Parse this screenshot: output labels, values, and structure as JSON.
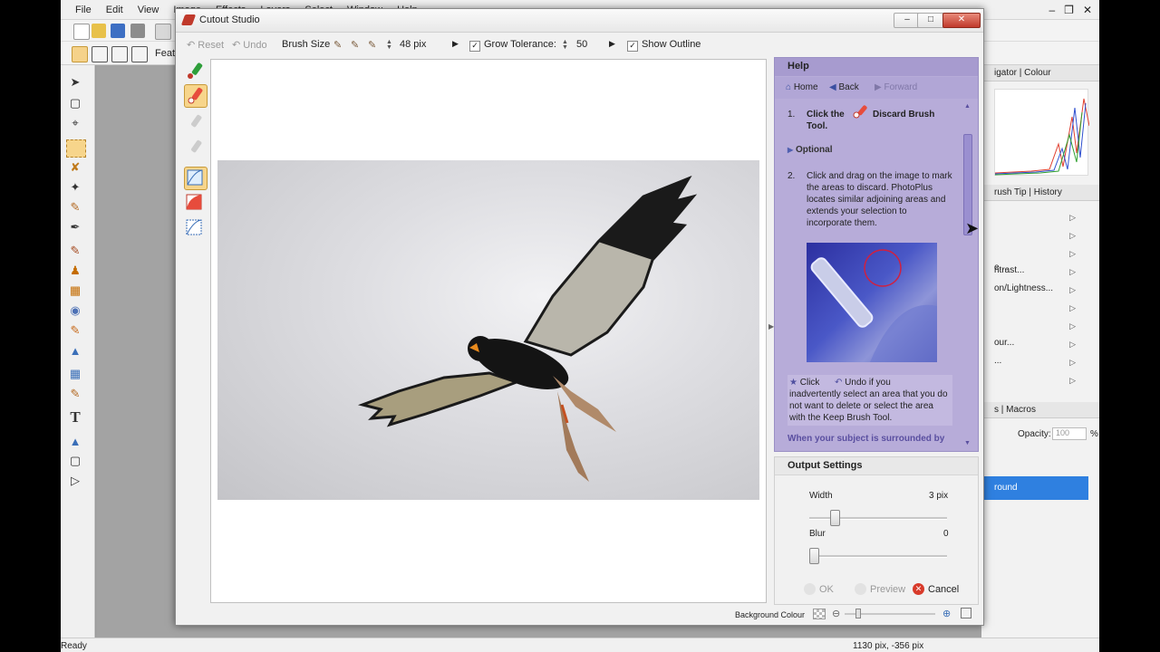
{
  "app": {
    "menu": [
      "File",
      "Edit",
      "View",
      "Image",
      "Effects",
      "Layers",
      "Select",
      "Window",
      "Help"
    ],
    "toolbar2_label": "Feat",
    "status_left": "Ready",
    "status_coords": "1130 pix, -356 pix",
    "right_panels": {
      "navigator_colour": "igator | Colour",
      "brushtip_history": "rush Tip | History",
      "adjust_items": [
        "e...",
        "ntrast...",
        "on/Lightness...",
        "our...",
        "..."
      ],
      "layers_macros": "s | Macros",
      "opacity_label": "Opacity:",
      "opacity_value": "100",
      "opacity_unit": "%",
      "layer_selected": "round"
    }
  },
  "dialog": {
    "title": "Cutout Studio",
    "toolbar": {
      "reset": "Reset",
      "undo": "Undo",
      "brush_size_label": "Brush Size",
      "brush_size_value": "48 pix",
      "grow_tolerance_label": "Grow Tolerance:",
      "grow_tolerance_value": "50",
      "show_outline_label": "Show Outline",
      "grow_tolerance_checked": true,
      "show_outline_checked": true
    },
    "help": {
      "title": "Help",
      "nav": {
        "home": "Home",
        "back": "Back",
        "forward": "Forward"
      },
      "step1_num": "1.",
      "step1_pre": "Click the",
      "step1_tool": "Discard Brush",
      "step1_tool2": "Tool.",
      "optional": "Optional",
      "step2_num": "2.",
      "step2_text": "Click and drag on the image to mark the areas to discard. PhotoPlus locates similar adjoining areas and extends your selection to incorporate them.",
      "tip_click": "Click",
      "tip_undo": "Undo if you",
      "tip_text": "inadvertently select an area that you do not want to delete or select the area with the Keep Brush Tool.",
      "bottom_text": "When your subject is surrounded by"
    },
    "output": {
      "title": "Output Settings",
      "width_label": "Width",
      "width_value": "3 pix",
      "width_fraction": 0.15,
      "blur_label": "Blur",
      "blur_value": "0",
      "blur_fraction": 0.0,
      "ok": "OK",
      "preview": "Preview",
      "cancel": "Cancel"
    },
    "background_colour_label": "Background Colour"
  }
}
